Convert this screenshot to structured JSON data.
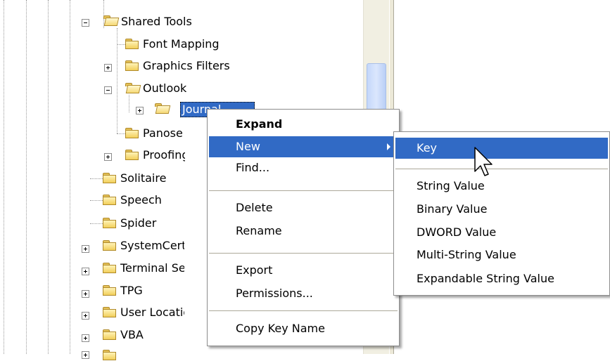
{
  "tree": {
    "items": [
      {
        "label": "Shared Tools"
      },
      {
        "label": "Font Mapping"
      },
      {
        "label": "Graphics Filters"
      },
      {
        "label": "Outlook"
      },
      {
        "label": "Journal"
      },
      {
        "label": "Panose"
      },
      {
        "label": "Proofing To"
      },
      {
        "label": "Solitaire"
      },
      {
        "label": "Speech"
      },
      {
        "label": "Spider"
      },
      {
        "label": "SystemCertifica"
      },
      {
        "label": "Terminal Serve"
      },
      {
        "label": "TPG"
      },
      {
        "label": "User Location S"
      },
      {
        "label": "VBA"
      }
    ]
  },
  "context_menu": {
    "expand": "Expand",
    "new": "New",
    "find": "Find...",
    "delete": "Delete",
    "rename": "Rename",
    "export": "Export",
    "permissions": "Permissions...",
    "copy_key_name": "Copy Key Name"
  },
  "submenu": {
    "key": "Key",
    "string_value": "String Value",
    "binary_value": "Binary Value",
    "dword_value": "DWORD Value",
    "multi_string_value": "Multi-String Value",
    "expandable_string_value": "Expandable String Value"
  },
  "colors": {
    "highlight": "#316ac5",
    "folder": "#f2cf5b"
  }
}
